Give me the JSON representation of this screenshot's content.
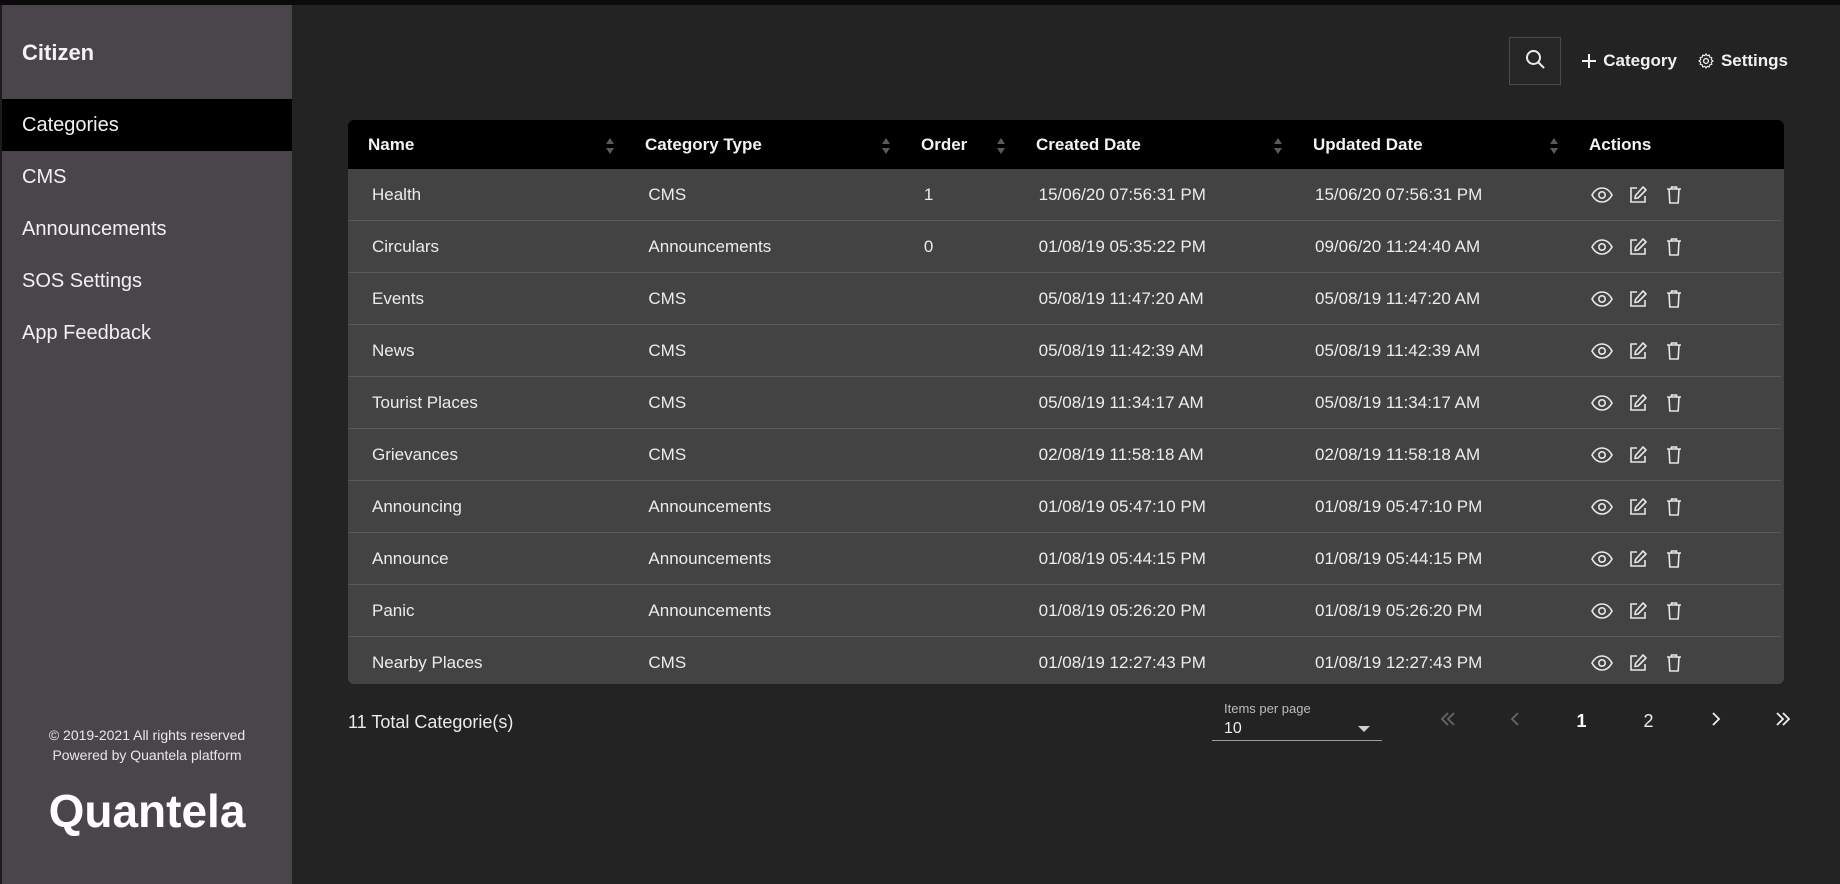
{
  "sidebar": {
    "app_title": "Citizen",
    "items": [
      {
        "label": "Categories",
        "active": true
      },
      {
        "label": "CMS",
        "active": false
      },
      {
        "label": "Announcements",
        "active": false
      },
      {
        "label": "SOS Settings",
        "active": false
      },
      {
        "label": "App Feedback",
        "active": false
      }
    ],
    "copyright": "© 2019-2021 All rights reserved",
    "powered_by": "Powered by Quantela platform",
    "brand": "Quantela"
  },
  "toolbar": {
    "search_icon": "search-icon",
    "add_category_label": "Category",
    "settings_label": "Settings"
  },
  "table": {
    "headers": {
      "name": "Name",
      "category_type": "Category Type",
      "order": "Order",
      "created_date": "Created Date",
      "updated_date": "Updated Date",
      "actions": "Actions"
    },
    "rows": [
      {
        "name": "Health",
        "type": "CMS",
        "order": "1",
        "created": "15/06/20 07:56:31 PM",
        "updated": "15/06/20 07:56:31 PM"
      },
      {
        "name": "Circulars",
        "type": "Announcements",
        "order": "0",
        "created": "01/08/19 05:35:22 PM",
        "updated": "09/06/20 11:24:40 AM"
      },
      {
        "name": "Events",
        "type": "CMS",
        "order": "",
        "created": "05/08/19 11:47:20 AM",
        "updated": "05/08/19 11:47:20 AM"
      },
      {
        "name": "News",
        "type": "CMS",
        "order": "",
        "created": "05/08/19 11:42:39 AM",
        "updated": "05/08/19 11:42:39 AM"
      },
      {
        "name": "Tourist Places",
        "type": "CMS",
        "order": "",
        "created": "05/08/19 11:34:17 AM",
        "updated": "05/08/19 11:34:17 AM"
      },
      {
        "name": "Grievances",
        "type": "CMS",
        "order": "",
        "created": "02/08/19 11:58:18 AM",
        "updated": "02/08/19 11:58:18 AM"
      },
      {
        "name": "Announcing",
        "type": "Announcements",
        "order": "",
        "created": "01/08/19 05:47:10 PM",
        "updated": "01/08/19 05:47:10 PM"
      },
      {
        "name": "Announce",
        "type": "Announcements",
        "order": "",
        "created": "01/08/19 05:44:15 PM",
        "updated": "01/08/19 05:44:15 PM"
      },
      {
        "name": "Panic",
        "type": "Announcements",
        "order": "",
        "created": "01/08/19 05:26:20 PM",
        "updated": "01/08/19 05:26:20 PM"
      },
      {
        "name": "Nearby Places",
        "type": "CMS",
        "order": "",
        "created": "01/08/19 12:27:43 PM",
        "updated": "01/08/19 12:27:43 PM"
      }
    ]
  },
  "pagination": {
    "total_text": "11 Total Categorie(s)",
    "items_per_page_label": "Items per page",
    "items_per_page_value": "10",
    "pages": [
      "1",
      "2"
    ],
    "current_page": "1"
  },
  "colors": {
    "background": "#232323",
    "sidebar": "#4a454b",
    "table_body": "#434343",
    "table_header": "#000000"
  }
}
